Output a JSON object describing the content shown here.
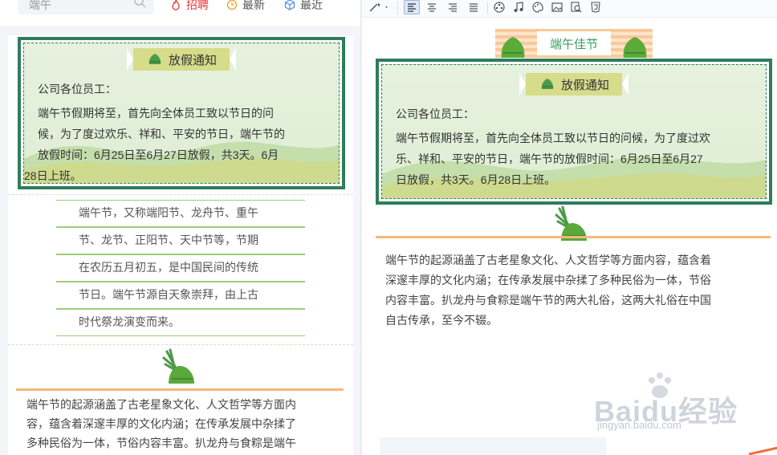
{
  "left_header": {
    "search_value": "端午",
    "tabs": [
      {
        "label": "招聘",
        "color": "#e33333"
      },
      {
        "label": "最新"
      },
      {
        "label": "最近"
      }
    ]
  },
  "left_preview": {
    "notice": {
      "title": "放假通知",
      "greeting": "公司各位员工：",
      "body": "端午节假期将至，首先向全体员工致以节日的问候，为了度过欢乐、祥和、平安的节日，端午节的放假时间：6月25日至6月27日放假，共3天。6月28日上班。",
      "lines": [
        "端午节假期将至，首先向全体员工致以节日的问",
        "候，为了度过欢乐、祥和、平安的节日，端午节的",
        "放假时间：6月25日至6月27日放假，共3天。6月",
        "28日上班。"
      ]
    },
    "lined_text": [
      "端午节，又称端阳节、龙舟节、重午",
      "节、龙节、正阳节、天中节等，节期",
      "在农历五月初五，是中国民间的传统",
      "节日。端午节源自天象崇拜，由上古",
      "时代祭龙演变而来。"
    ],
    "origin_lines": [
      "端午节的起源涵盖了古老星象文化、人文哲学等方面内",
      "容，蕴含着深邃丰厚的文化内涵；在传承发展中杂揉了",
      "多种民俗为一体，节俗内容丰富。扒龙舟与食粽是端午"
    ]
  },
  "editor": {
    "toolbar": {
      "icons": [
        "magic-wand-icon",
        "align-left-icon",
        "align-center-icon",
        "align-right-icon",
        "align-justify-icon",
        "film-icon",
        "music-icon",
        "palette-icon",
        "image-icon",
        "find-replace-icon",
        "html5-icon"
      ]
    },
    "banner_title": "端午佳节",
    "notice": {
      "title": "放假通知",
      "greeting": "公司各位员工：",
      "lines": [
        "端午节假期将至，首先向全体员工致以节日的问候，为了度过欢",
        "乐、祥和、平安的节日，端午节的放假时间：6月25日至6月27",
        "日放假，共3天。6月28日上班。"
      ]
    },
    "origin_lines": [
      "端午节的起源涵盖了古老星象文化、人文哲学等方面内容，蕴含着",
      "深邃丰厚的文化内涵；在传承发展中杂揉了多种民俗为一体，节俗",
      "内容丰富。扒龙舟与食粽是端午节的两大礼俗，这两大礼俗在中国",
      "自古传承，至今不辍。"
    ]
  },
  "watermark": {
    "brand": "Baidu经验",
    "url": "jingyan.baidu.com"
  },
  "colors": {
    "frame_green": "#2e7d5b",
    "title_band": "#d7dc8a",
    "accent_orange": "#f4b87a",
    "banner_green": "#3d9b63"
  }
}
